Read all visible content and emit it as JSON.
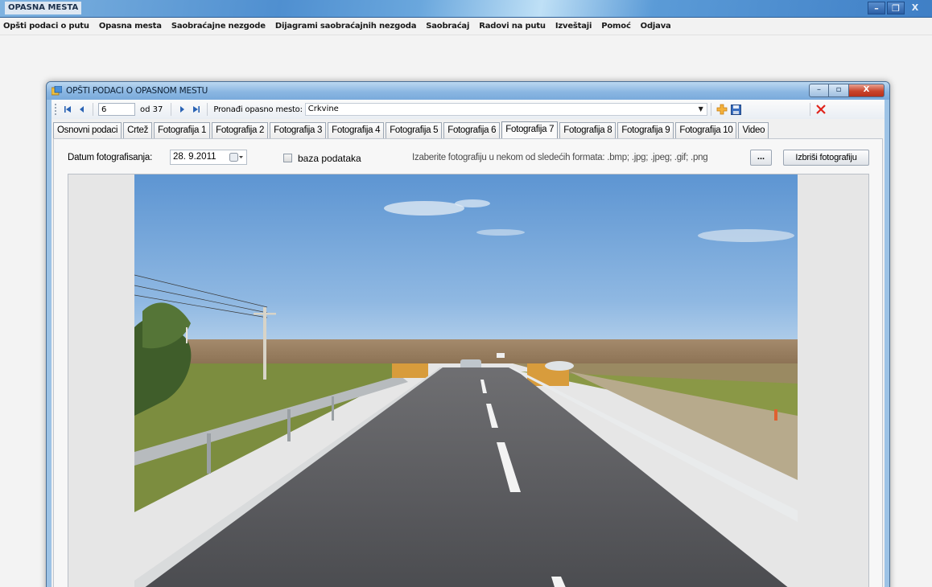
{
  "app": {
    "title": "OPASNA MESTA",
    "window_buttons": {
      "minimize": "–",
      "maximize": "❐",
      "close": "X"
    },
    "menu": [
      "Opšti podaci o putu",
      "Opasna mesta",
      "Saobraćajne nezgode",
      "Dijagrami saobraćajnih nezgoda",
      "Saobraćaj",
      "Radovi na putu",
      "Izveštaji",
      "Pomoć",
      "Odjava"
    ]
  },
  "child_window": {
    "title": "OPŠTI PODACI O OPASNOM MESTU",
    "window_buttons": {
      "minimize": "–",
      "maximize": "▫",
      "close": "X"
    },
    "navigator": {
      "current_record": "6",
      "record_count": "od 37",
      "find_label": "Pronađi opasno mesto:",
      "find_value": "Crkvine"
    },
    "tabs": [
      "Osnovni podaci",
      "Crtež",
      "Fotografija 1",
      "Fotografija 2",
      "Fotografija 3",
      "Fotografija 4",
      "Fotografija 5",
      "Fotografija 6",
      "Fotografija 7",
      "Fotografija 8",
      "Fotografija 9",
      "Fotografija 10",
      "Video"
    ],
    "active_tab": "Fotografija 7",
    "photo_tab": {
      "date_label": "Datum fotografisanja:",
      "date_value": "28.  9.2011",
      "database_checkbox_label": "baza podataka",
      "database_checked": false,
      "format_hint": "Izaberite fotografiju u nekom od sledećih formata: .bmp; .jpg; .jpeg; .gif; .png",
      "browse_button": "...",
      "delete_button": "Izbriši fotografiju"
    }
  },
  "colors": {
    "titlebar_blue": "#4f8fd0",
    "close_red": "#c9452c",
    "delete_x_red": "#e0231b",
    "sky": "#5d95d2"
  }
}
